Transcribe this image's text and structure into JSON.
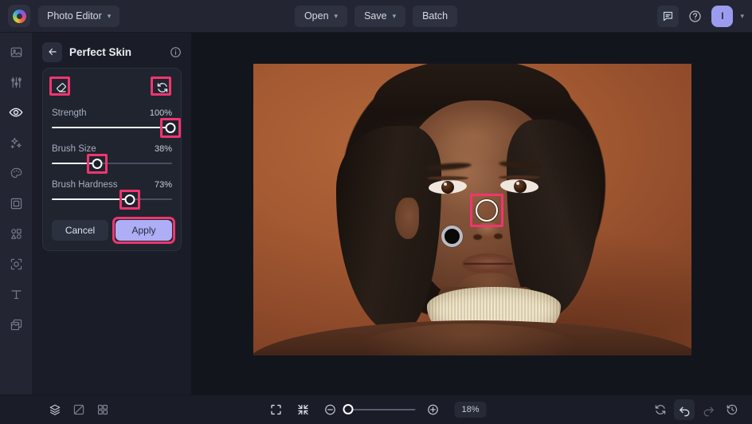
{
  "app": {
    "logo": "color-wheel-logo",
    "product_menu": "Photo Editor"
  },
  "topbar": {
    "open_label": "Open",
    "save_label": "Save",
    "batch_label": "Batch",
    "feedback_icon": "chat-bubble-icon",
    "help_icon": "question-mark-icon",
    "avatar_initial": "I"
  },
  "sidebar": {
    "items": [
      {
        "name": "sidebar-item-photos",
        "icon": "image-icon",
        "active": false
      },
      {
        "name": "sidebar-item-adjust",
        "icon": "sliders-icon",
        "active": false
      },
      {
        "name": "sidebar-item-retouch",
        "icon": "eye-icon",
        "active": true
      },
      {
        "name": "sidebar-item-effects",
        "icon": "sparkles-icon",
        "active": false
      },
      {
        "name": "sidebar-item-color",
        "icon": "palette-icon",
        "active": false
      },
      {
        "name": "sidebar-item-frames",
        "icon": "frame-icon",
        "active": false
      },
      {
        "name": "sidebar-item-elements",
        "icon": "shapes-icon",
        "active": false
      },
      {
        "name": "sidebar-item-background",
        "icon": "crop-subject-icon",
        "active": false
      },
      {
        "name": "sidebar-item-text",
        "icon": "text-icon",
        "active": false
      },
      {
        "name": "sidebar-item-overlays",
        "icon": "layers-stack-icon",
        "active": false
      }
    ]
  },
  "panel": {
    "back_icon": "back-arrow-icon",
    "title": "Perfect Skin",
    "info_icon": "info-circle-icon",
    "tools": {
      "eraser_icon": "eraser-icon",
      "reset_icon": "reset-refresh-icon"
    },
    "sliders": [
      {
        "label": "Strength",
        "value": "100%",
        "percent": 100
      },
      {
        "label": "Brush Size",
        "value": "38%",
        "percent": 38
      },
      {
        "label": "Brush Hardness",
        "value": "73%",
        "percent": 73
      }
    ],
    "cancel_label": "Cancel",
    "apply_label": "Apply"
  },
  "canvas": {
    "brush_cursor": "brush-cursor-circle",
    "image_alt": "portrait-photo"
  },
  "bottombar": {
    "layers_icon": "layers-icon",
    "compare_icon": "compare-split-icon",
    "grid_icon": "grid-view-icon",
    "fit_icon": "fit-to-screen-icon",
    "actual_icon": "collapse-arrows-icon",
    "zoom_out_icon": "zoom-out-icon",
    "zoom_in_icon": "zoom-in-icon",
    "zoom_level": "18%",
    "zoom_percent": 6,
    "reset_icon": "reset-view-icon",
    "undo_icon": "undo-icon",
    "redo_icon": "redo-icon",
    "history_icon": "history-clock-icon"
  },
  "highlights": {
    "accent_color": "#f0356f",
    "boxes": [
      "eraser-tool",
      "reset-tool",
      "strength-thumb",
      "brush-size-thumb",
      "brush-hardness-thumb",
      "apply-button",
      "brush-cursor"
    ]
  },
  "colors": {
    "apply_button": "#adaef6",
    "avatar": "#9b9cf0",
    "panel_bg": "#1a1d27",
    "topbar_bg": "#232632",
    "canvas_bg": "#13151d",
    "photo_backdrop": "#9d5532"
  }
}
